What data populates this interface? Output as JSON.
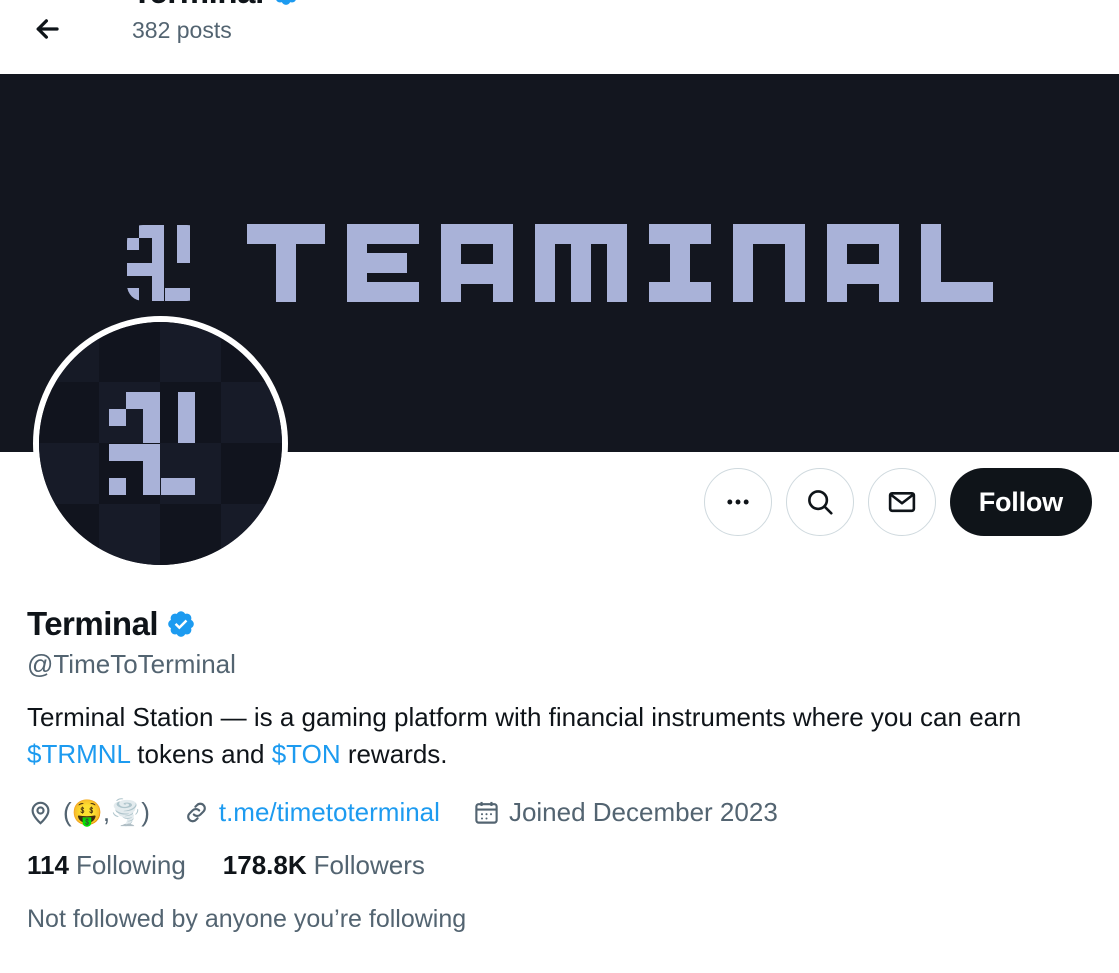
{
  "header": {
    "back_icon": "back-arrow-icon",
    "title": "Terminal",
    "verified_icon": "verified-badge-icon",
    "posts_count": "382 posts"
  },
  "banner": {
    "alt_text": "TERMINAL",
    "wordmark": "TERMINAL",
    "background_color": "#13161f",
    "logo_color": "#a9b2d8"
  },
  "avatar": {
    "alt_text": "Terminal avatar",
    "background_color": "#141824",
    "glyph_color": "#a9b2d8"
  },
  "actions": {
    "more_icon": "more-horizontal-icon",
    "more_label": "More",
    "search_icon": "search-icon",
    "search_label": "Search",
    "message_icon": "envelope-icon",
    "message_label": "Message",
    "follow_label": "Follow"
  },
  "profile": {
    "display_name": "Terminal",
    "verified_icon": "verified-badge-icon",
    "handle": "@TimeToTerminal",
    "bio_part1": "Terminal Station — is a gaming platform with financial instruments where you can earn ",
    "bio_link1": "$TRMNL",
    "bio_part2": " tokens and ",
    "bio_link2": "$TON",
    "bio_part3": " rewards.",
    "location_icon": "location-pin-icon",
    "location_open": "(",
    "location_emoji1": "🤑",
    "location_comma": ",",
    "location_emoji2": "🌪️",
    "location_close": ")",
    "link_icon": "link-icon",
    "link_text": "t.me/timetoterminal",
    "joined_icon": "calendar-icon",
    "joined_text": "Joined December 2023",
    "following_count": "114",
    "following_label": "Following",
    "followers_count": "178.8K",
    "followers_label": "Followers",
    "followed_note": "Not followed by anyone you’re following"
  },
  "colors": {
    "accent_blue": "#1d9bf0",
    "text_primary": "#0f1419",
    "text_secondary": "#536471",
    "follow_button_bg": "#0f1419"
  }
}
